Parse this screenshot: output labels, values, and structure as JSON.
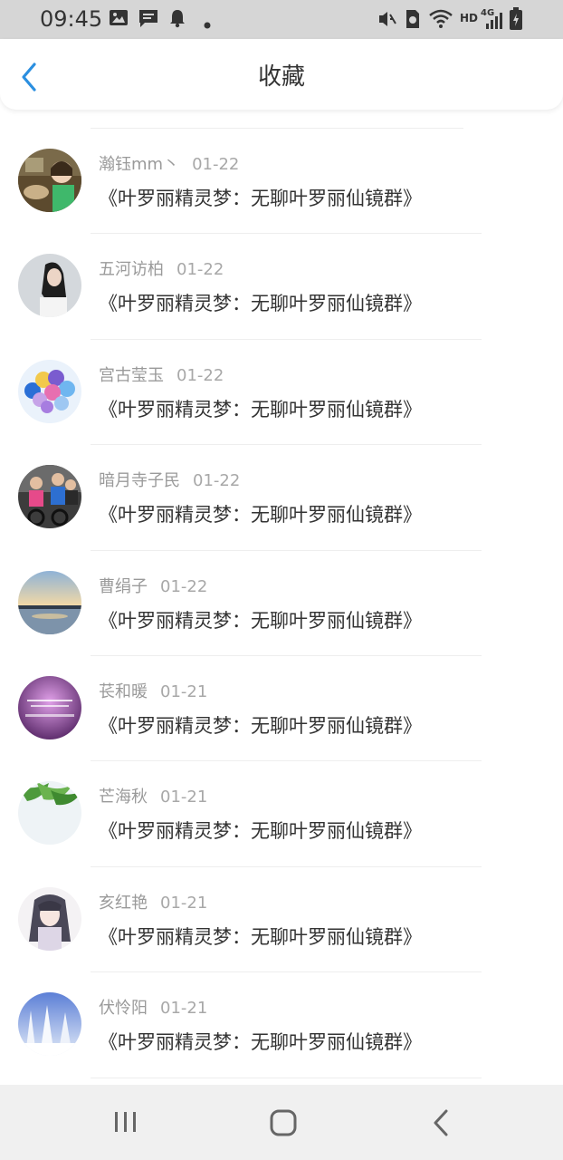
{
  "status_bar": {
    "time": "09:45",
    "icons": [
      "image-icon",
      "message-icon",
      "bell-icon",
      "dot-icon",
      "mute-icon",
      "sim-icon",
      "wifi-icon",
      "hd-icon",
      "signal-4g-icon",
      "battery-icon"
    ],
    "hd_label": "HD",
    "net_label": "4G"
  },
  "header": {
    "title": "收藏",
    "back_icon": "chevron-left-icon",
    "accent_color": "#2b8fe0"
  },
  "items": [
    {
      "name": "瀚钰mm丶",
      "date": "01-22",
      "message": "《叶罗丽精灵梦：无聊叶罗丽仙镜群》",
      "avatar": "avatar-photo-girl-table"
    },
    {
      "name": "五河访柏",
      "date": "01-22",
      "message": "《叶罗丽精灵梦：无聊叶罗丽仙镜群》",
      "avatar": "avatar-photo-girl-dark-hair"
    },
    {
      "name": "宫古莹玉",
      "date": "01-22",
      "message": "《叶罗丽精灵梦：无聊叶罗丽仙镜群》",
      "avatar": "avatar-balloons"
    },
    {
      "name": "暗月寺子民",
      "date": "01-22",
      "message": "《叶罗丽精灵梦：无聊叶罗丽仙镜群》",
      "avatar": "avatar-cycling"
    },
    {
      "name": "曹绢子",
      "date": "01-22",
      "message": "《叶罗丽精灵梦：无聊叶罗丽仙镜群》",
      "avatar": "avatar-sunset-lake"
    },
    {
      "name": "苌和暖",
      "date": "01-21",
      "message": "《叶罗丽精灵梦：无聊叶罗丽仙镜群》",
      "avatar": "avatar-purple-text"
    },
    {
      "name": "芒海秋",
      "date": "01-21",
      "message": "《叶罗丽精灵梦：无聊叶罗丽仙镜群》",
      "avatar": "avatar-green-leaves"
    },
    {
      "name": "亥红艳",
      "date": "01-21",
      "message": "《叶罗丽精灵梦：无聊叶罗丽仙镜群》",
      "avatar": "avatar-anime-character"
    },
    {
      "name": "伏怜阳",
      "date": "01-21",
      "message": "《叶罗丽精灵梦：无聊叶罗丽仙镜群》",
      "avatar": "avatar-snow-trees"
    }
  ],
  "nav_bar": {
    "recent_icon": "recent-apps-icon",
    "home_icon": "home-icon",
    "back_icon": "back-icon"
  }
}
